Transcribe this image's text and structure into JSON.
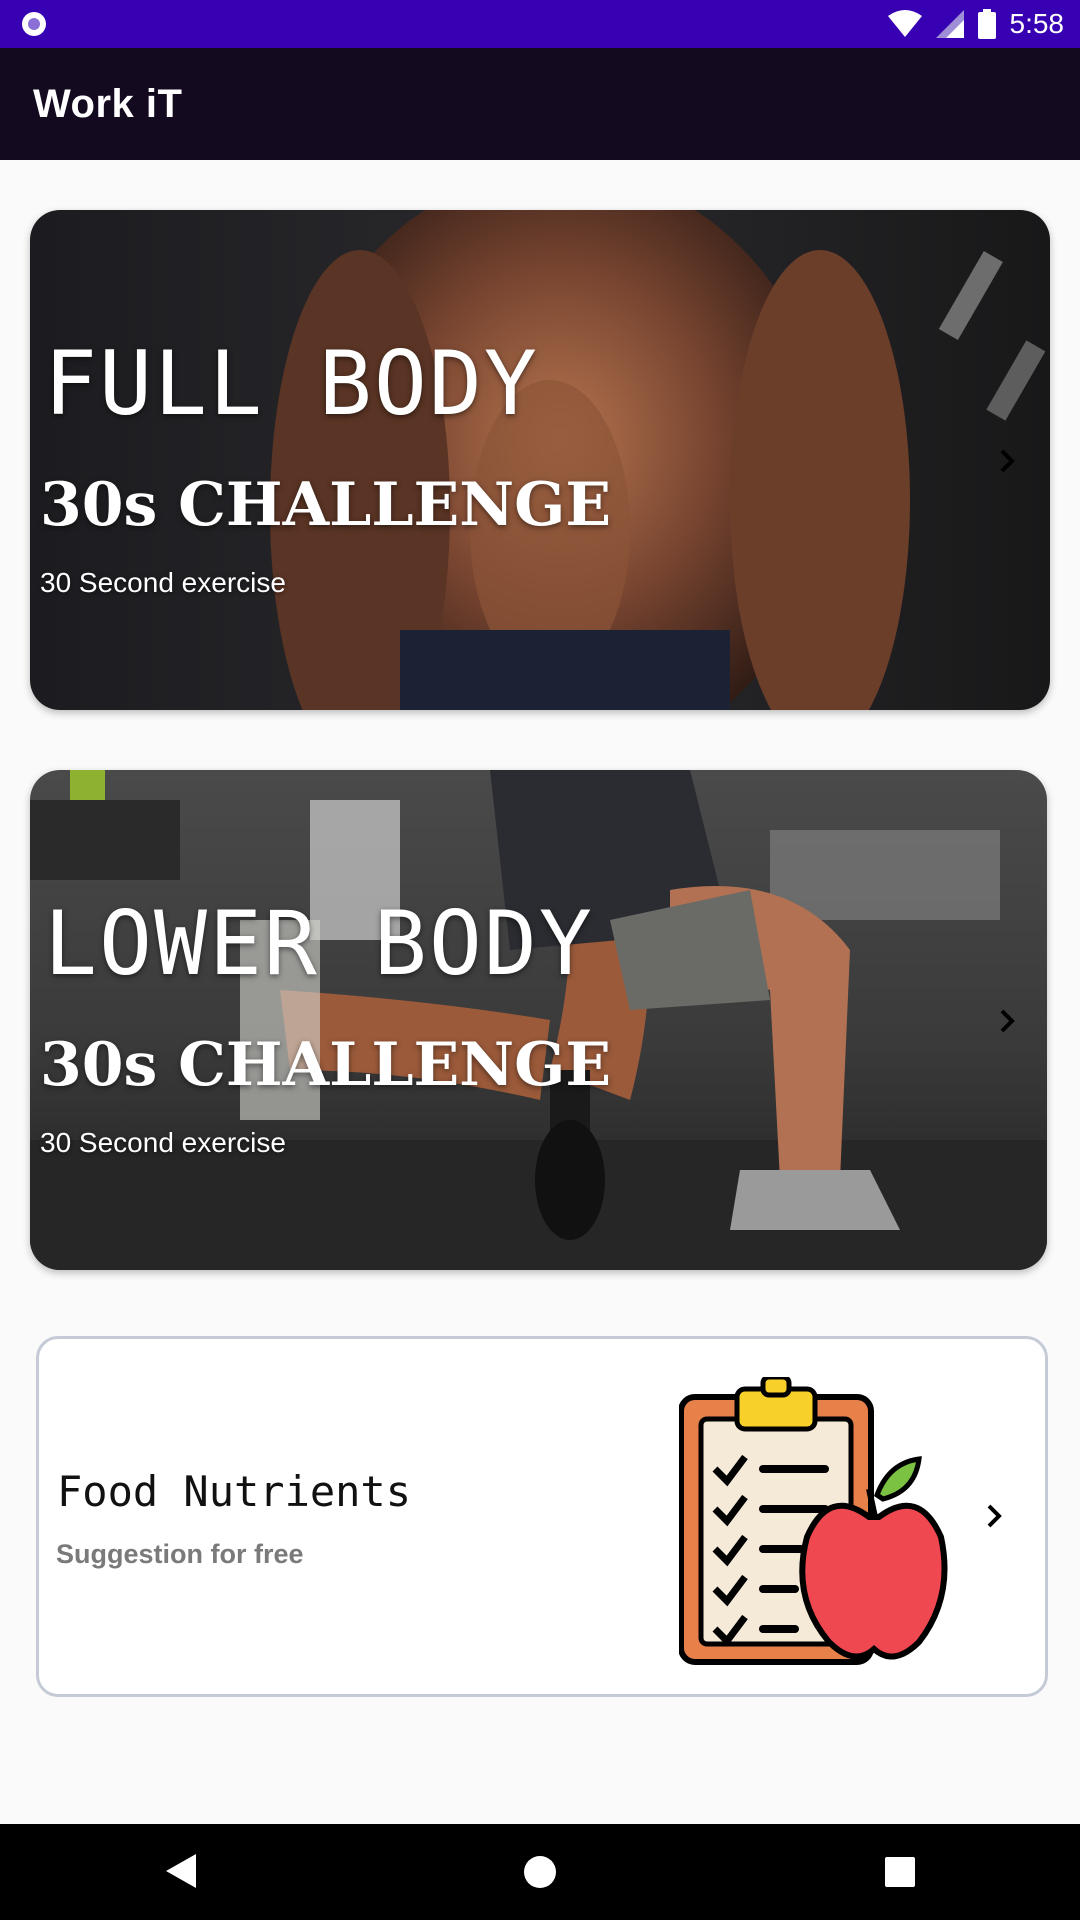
{
  "status_bar": {
    "time": "5:58"
  },
  "app_bar": {
    "title": "Work iT"
  },
  "workouts": [
    {
      "title": "FULL BODY",
      "subtitle": "30s CHALLENGE",
      "note": "30 Second exercise"
    },
    {
      "title": "LOWER BODY",
      "subtitle": "30s CHALLENGE",
      "note": "30 Second exercise"
    }
  ],
  "food_card": {
    "title": "Food Nutrients",
    "subtitle": "Suggestion for free"
  },
  "colors": {
    "status_bar": "#3700b3",
    "app_bar": "#140a1f",
    "background": "#fafafa",
    "card_border": "#c5cbd6",
    "muted_text": "#7a7a7a"
  },
  "icons": {
    "status_left": "notification-dot-icon",
    "wifi": "wifi-icon",
    "signal": "signal-icon",
    "battery": "battery-icon",
    "chevron": "chevron-right-icon",
    "food": "clipboard-apple-icon",
    "back": "back-icon",
    "home": "home-icon",
    "recents": "recents-icon"
  }
}
